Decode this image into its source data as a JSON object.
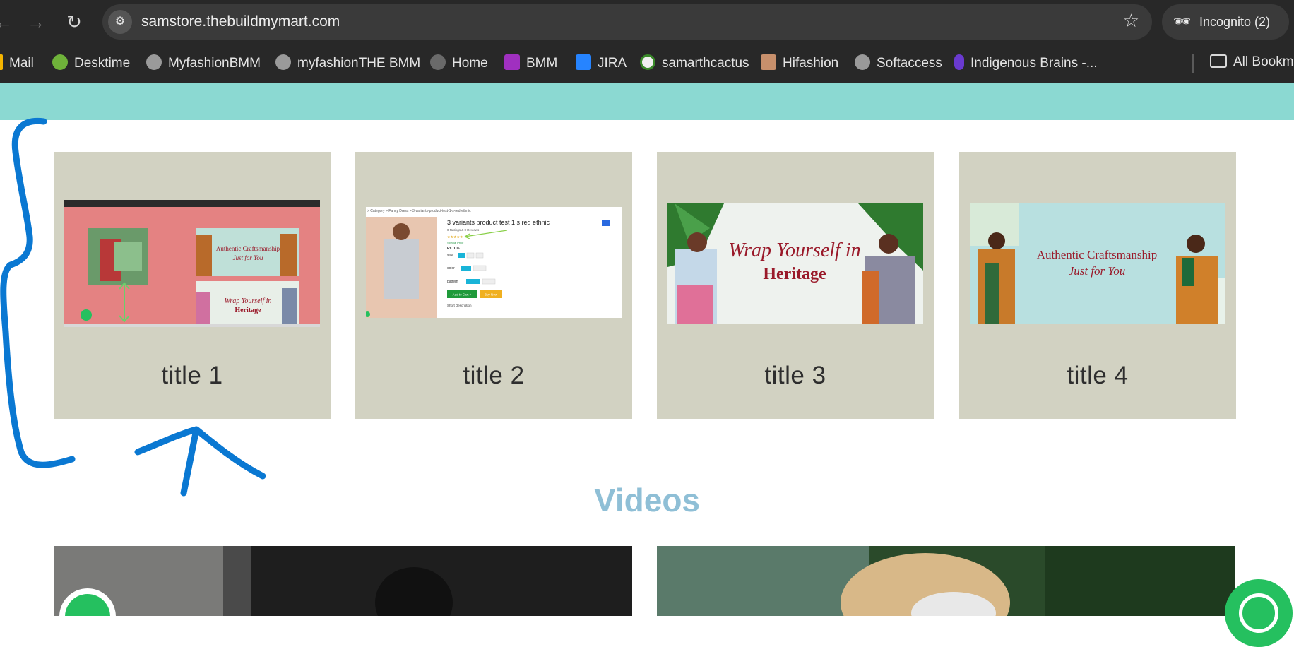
{
  "browser": {
    "url": "samstore.thebuildmymart.com",
    "incognito_label": "Incognito (2)",
    "bookmarks": [
      {
        "label": "Mail",
        "icon": "mail-icon",
        "color": "#f4b400"
      },
      {
        "label": "Desktime",
        "icon": "desktime-icon",
        "color": "#6fb33a"
      },
      {
        "label": "MyfashionBMM",
        "icon": "globe-icon",
        "color": "#9a9a9a"
      },
      {
        "label": "myfashionTHE BMM",
        "icon": "globe-icon",
        "color": "#9a9a9a"
      },
      {
        "label": "Home",
        "icon": "globe-icon",
        "color": "#6a6a6a"
      },
      {
        "label": "BMM",
        "icon": "bmm-icon",
        "color": "#a030c0"
      },
      {
        "label": "JIRA",
        "icon": "jira-icon",
        "color": "#2684ff"
      },
      {
        "label": "samarthcactus",
        "icon": "cactus-icon",
        "color": "#3a8a2a"
      },
      {
        "label": "Hifashion",
        "icon": "hifashion-icon",
        "color": "#c8906c"
      },
      {
        "label": "Softaccess",
        "icon": "globe-icon",
        "color": "#9a9a9a"
      },
      {
        "label": "Indigenous Brains -...",
        "icon": "indigenous-brains-icon",
        "color": "#6a3ad0"
      }
    ],
    "all_bookmarks_label": "All Bookm"
  },
  "cards": [
    {
      "title": "title 1",
      "thumb_banner_1": "Authentic Craftsmanship",
      "thumb_banner_1b": "Just for You",
      "thumb_banner_2": "Wrap Yourself in",
      "thumb_banner_2b": "Heritage"
    },
    {
      "title": "title 2",
      "product_title": "3 variants product test 1 s red ethnic",
      "breadcrumb": "> Category > Fancy Dress > 3-variants-product-test-1-s-red-ethnic",
      "ratings": "0 Ratings & 0 Reviews",
      "special_price": "Special Price",
      "price": "Rs. 105",
      "size_label": "size",
      "sizes": [
        "S",
        "M",
        "L"
      ],
      "color_label": "color",
      "colors": [
        "red",
        "black"
      ],
      "pattern_label": "pattern",
      "patterns": [
        "ethnic",
        "royal"
      ],
      "add_to_cart": "Add to Cart +",
      "buy_now": "Buy Now",
      "short_description": "Short Description"
    },
    {
      "title": "title 3",
      "banner_line1": "Wrap Yourself in",
      "banner_line2": "Heritage"
    },
    {
      "title": "title 4",
      "banner_line1": "Authentic Craftsmanship",
      "banner_line2": "Just for You"
    }
  ],
  "videos_heading": "Videos",
  "colors": {
    "teal_band": "#8bd9d2",
    "card_bg": "#d2d2c2",
    "videos_heading": "#8fbfd6",
    "annotation": "#0a78d2",
    "whatsapp": "#25c05f"
  }
}
